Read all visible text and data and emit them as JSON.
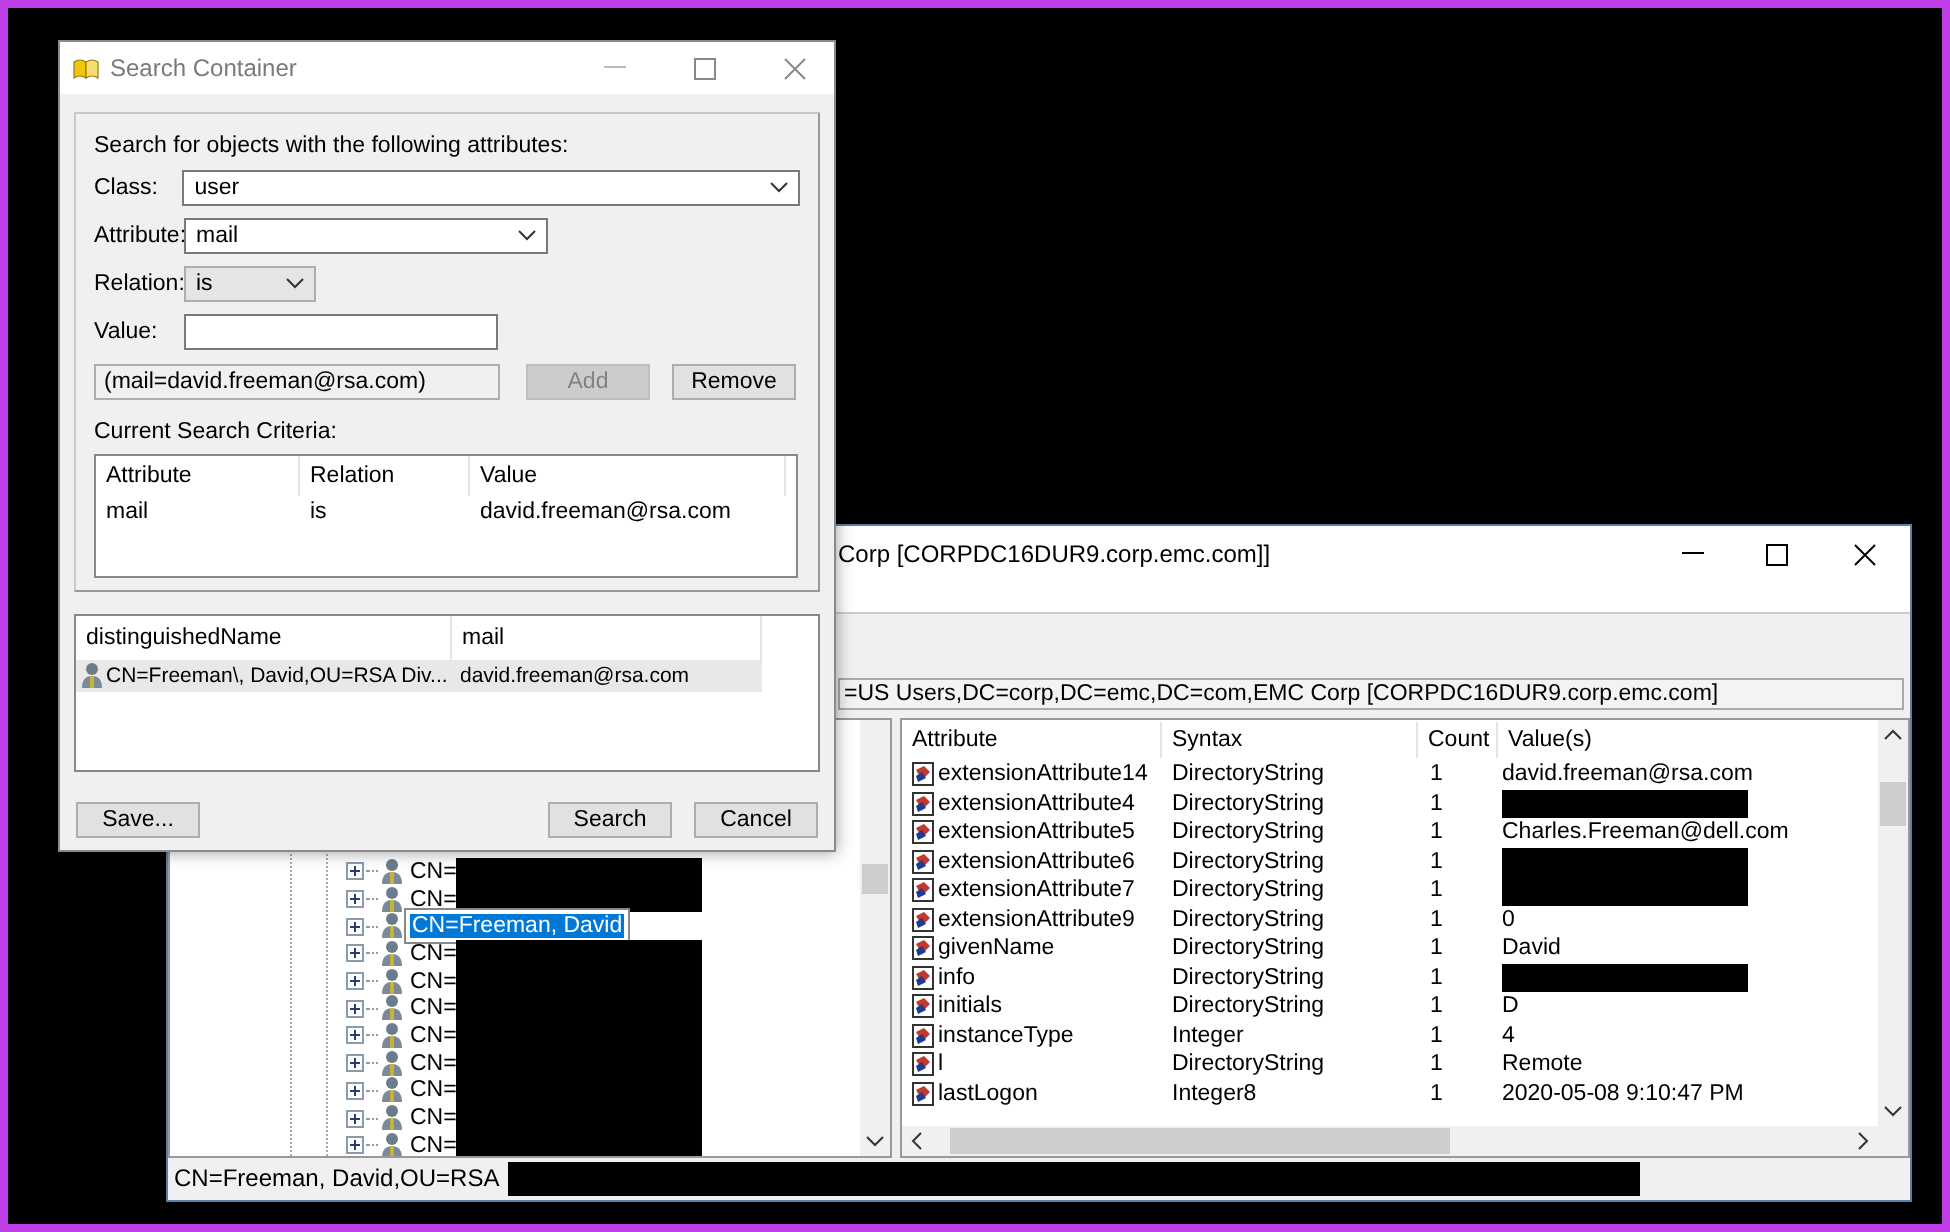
{
  "main_window": {
    "title": "Corp [CORPDC16DUR9.corp.emc.com]]",
    "path": "=US Users,DC=corp,DC=emc,DC=com,EMC Corp [CORPDC16DUR9.corp.emc.com]",
    "tree": {
      "items": [
        {
          "label": "CN=",
          "redacted": true,
          "selected": false
        },
        {
          "label": "CN=",
          "redacted": true,
          "selected": false
        },
        {
          "label": "CN=Freeman, David",
          "redacted": false,
          "selected": true
        },
        {
          "label": "CN=",
          "redacted": true,
          "selected": false
        },
        {
          "label": "CN=",
          "redacted": true,
          "selected": false
        },
        {
          "label": "CN=",
          "redacted": true,
          "selected": false
        },
        {
          "label": "CN=",
          "redacted": true,
          "selected": false
        },
        {
          "label": "CN=",
          "redacted": true,
          "selected": false
        },
        {
          "label": "CN=",
          "redacted": true,
          "selected": false
        },
        {
          "label": "CN=",
          "redacted": true,
          "selected": false
        },
        {
          "label": "CN=",
          "redacted": true,
          "selected": false
        }
      ]
    },
    "attributes": {
      "columns": [
        "Attribute",
        "Syntax",
        "Count",
        "Value(s)"
      ],
      "rows": [
        {
          "attribute": "extensionAttribute14",
          "syntax": "DirectoryString",
          "count": "1",
          "value": "david.freeman@rsa.com",
          "redacted": false
        },
        {
          "attribute": "extensionAttribute4",
          "syntax": "DirectoryString",
          "count": "1",
          "redacted": true
        },
        {
          "attribute": "extensionAttribute5",
          "syntax": "DirectoryString",
          "count": "1",
          "value": "Charles.Freeman@dell.com",
          "redacted": false
        },
        {
          "attribute": "extensionAttribute6",
          "syntax": "DirectoryString",
          "count": "1",
          "redacted": true
        },
        {
          "attribute": "extensionAttribute7",
          "syntax": "DirectoryString",
          "count": "1",
          "redacted": true
        },
        {
          "attribute": "extensionAttribute9",
          "syntax": "DirectoryString",
          "count": "1",
          "value": "0",
          "redacted": false
        },
        {
          "attribute": "givenName",
          "syntax": "DirectoryString",
          "count": "1",
          "value": "David",
          "redacted": false
        },
        {
          "attribute": "info",
          "syntax": "DirectoryString",
          "count": "1",
          "redacted": true
        },
        {
          "attribute": "initials",
          "syntax": "DirectoryString",
          "count": "1",
          "value": "D",
          "redacted": false
        },
        {
          "attribute": "instanceType",
          "syntax": "Integer",
          "count": "1",
          "value": "4",
          "redacted": false
        },
        {
          "attribute": "l",
          "syntax": "DirectoryString",
          "count": "1",
          "value": "Remote",
          "redacted": false
        },
        {
          "attribute": "lastLogon",
          "syntax": "Integer8",
          "count": "1",
          "value": "2020-05-08 9:10:47 PM",
          "redacted": false
        }
      ]
    },
    "status_bar": {
      "text": "CN=Freeman, David,OU=RSA",
      "redacted": true
    }
  },
  "search_dialog": {
    "title": "Search Container",
    "prompt": "Search for objects with the following attributes:",
    "class": {
      "label": "Class:",
      "value": "user"
    },
    "attribute": {
      "label": "Attribute:",
      "value": "mail"
    },
    "relation": {
      "label": "Relation:",
      "value": "is"
    },
    "value": {
      "label": "Value:"
    },
    "filter": "(mail=david.freeman@rsa.com)",
    "add_button": {
      "label": "Add",
      "disabled": true
    },
    "remove_button": {
      "label": "Remove",
      "disabled": false
    },
    "criteria": {
      "label": "Current Search Criteria:",
      "columns": [
        "Attribute",
        "Relation",
        "Value"
      ],
      "rows": [
        {
          "attribute": "mail",
          "relation": "is",
          "value": "david.freeman@rsa.com"
        }
      ]
    },
    "results": {
      "columns": [
        "distinguishedName",
        "mail"
      ],
      "rows": [
        {
          "distinguished_name": "CN=Freeman\\, David,OU=RSA Div...",
          "mail": "david.freeman@rsa.com",
          "selected": true
        }
      ]
    },
    "buttons": {
      "save": "Save...",
      "search": "Search",
      "cancel": "Cancel"
    }
  }
}
